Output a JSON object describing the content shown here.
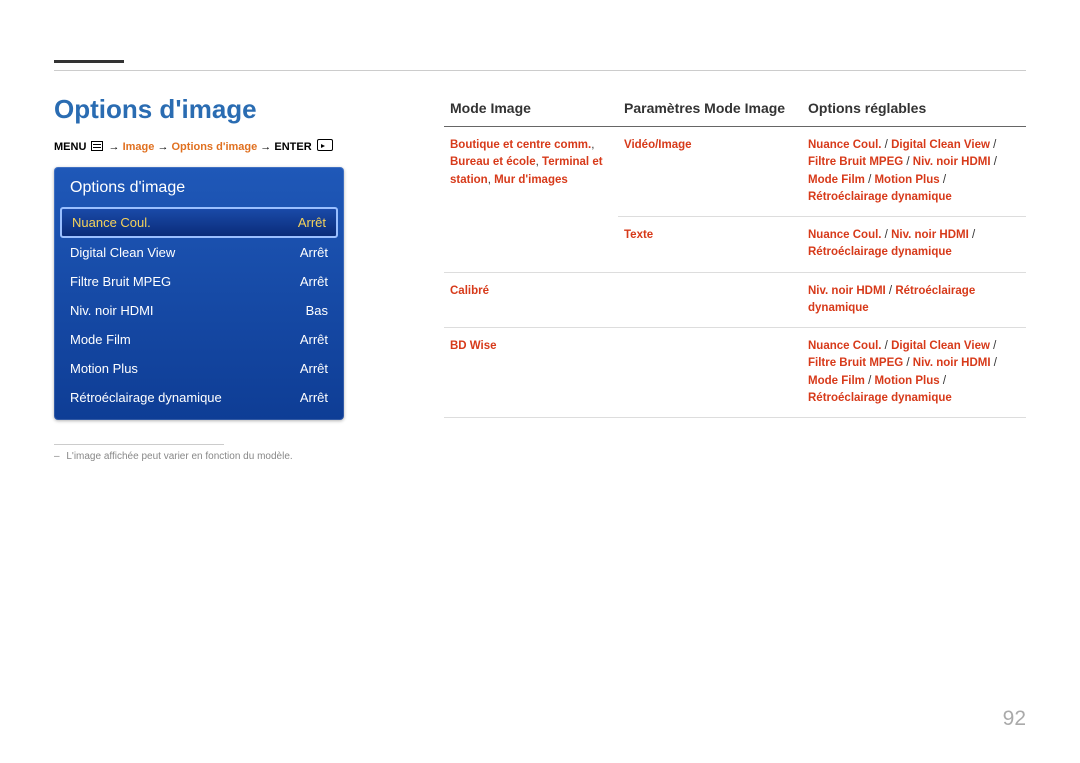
{
  "page_title": "Options d'image",
  "breadcrumb": {
    "menu": "MENU",
    "arrow": "→",
    "p1": "Image",
    "p2": "Options d'image",
    "enter": "ENTER"
  },
  "osd": {
    "title": "Options d'image",
    "items": [
      {
        "label": "Nuance Coul.",
        "value": "Arrêt",
        "selected": true
      },
      {
        "label": "Digital Clean View",
        "value": "Arrêt",
        "selected": false
      },
      {
        "label": "Filtre Bruit MPEG",
        "value": "Arrêt",
        "selected": false
      },
      {
        "label": "Niv. noir HDMI",
        "value": "Bas",
        "selected": false
      },
      {
        "label": "Mode Film",
        "value": "Arrêt",
        "selected": false
      },
      {
        "label": "Motion Plus",
        "value": "Arrêt",
        "selected": false
      },
      {
        "label": "Rétroéclairage dynamique",
        "value": "Arrêt",
        "selected": false
      }
    ]
  },
  "footnote": "L'image affichée peut varier en fonction du modèle.",
  "table": {
    "headers": [
      "Mode Image",
      "Paramètres Mode Image",
      "Options réglables"
    ],
    "rows": [
      {
        "c1_parts": [
          "Boutique et centre comm.",
          ", ",
          "Bureau et école",
          ", ",
          "Terminal et station",
          ", ",
          "Mur d'images"
        ],
        "c2_parts": [
          "Vidéo/Image"
        ],
        "c3_parts": [
          "Nuance Coul.",
          " / ",
          "Digital Clean View",
          " / ",
          "Filtre Bruit MPEG",
          " / ",
          "Niv. noir HDMI",
          " / ",
          "Mode Film",
          " / ",
          "Motion Plus",
          " / ",
          "Rétroéclairage dynamique"
        ]
      },
      {
        "c1_parts": [
          ""
        ],
        "c2_parts": [
          "Texte"
        ],
        "c3_parts": [
          "Nuance Coul.",
          " / ",
          "Niv. noir HDMI",
          " / ",
          "Rétroéclairage dynamique"
        ]
      },
      {
        "c1_parts": [
          "Calibré"
        ],
        "c2_parts": [
          ""
        ],
        "c3_parts": [
          "Niv. noir HDMI",
          " / ",
          "Rétroéclairage dynamique"
        ]
      },
      {
        "c1_parts": [
          "BD Wise"
        ],
        "c2_parts": [
          ""
        ],
        "c3_parts": [
          "Nuance Coul.",
          " / ",
          "Digital Clean View",
          " / ",
          "Filtre Bruit MPEG",
          " / ",
          "Niv. noir HDMI",
          " / ",
          "Mode Film",
          " / ",
          "Motion Plus",
          " / ",
          "Rétroéclairage dynamique"
        ]
      }
    ]
  },
  "page_number": "92"
}
